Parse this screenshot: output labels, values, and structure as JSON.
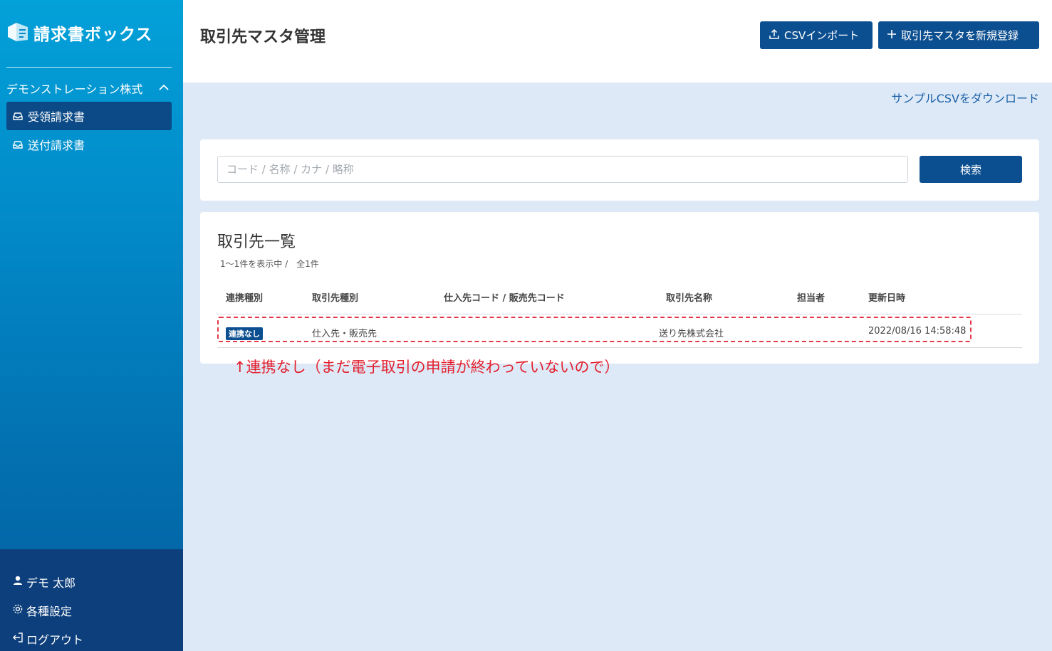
{
  "sidebar": {
    "logo_text": "請求書ボックス",
    "company": "デモンストレーション株式",
    "items": [
      {
        "label": "受領請求書",
        "icon": "inbox-icon"
      },
      {
        "label": "送付請求書",
        "icon": "inbox-icon"
      }
    ],
    "bottom": [
      {
        "label": "デモ 太郎",
        "icon": "user-icon"
      },
      {
        "label": "各種設定",
        "icon": "gear-icon"
      },
      {
        "label": "ログアウト",
        "icon": "logout-icon"
      }
    ]
  },
  "header": {
    "title": "取引先マスタ管理",
    "import_label": "CSVインポート",
    "new_label": "取引先マスタを新規登録",
    "sample_link": "サンプルCSVをダウンロード"
  },
  "search": {
    "placeholder": "コード / 名称 / カナ / 略称",
    "value": "",
    "button_label": "検索"
  },
  "list": {
    "title": "取引先一覧",
    "count_text": "1〜1件を表示中 /　全1件",
    "columns": [
      "連携種別",
      "取引先種別",
      "仕入先コード / 販売先コード",
      "取引先名称",
      "担当者",
      "更新日時"
    ],
    "rows": [
      {
        "link": "連携なし",
        "type": "仕入先・販売先",
        "code": "",
        "name": "送り先株式会社",
        "owner": "",
        "updated": "2022/08/16 14:58:48"
      }
    ]
  },
  "annotation": "↑連携なし（まだ電子取引の申請が終わっていないので）",
  "colors": {
    "primary": "#0c4f90",
    "sidebar_top": "#03a1d9",
    "annotation": "#e3202f",
    "content_bg": "#dde9f6"
  }
}
